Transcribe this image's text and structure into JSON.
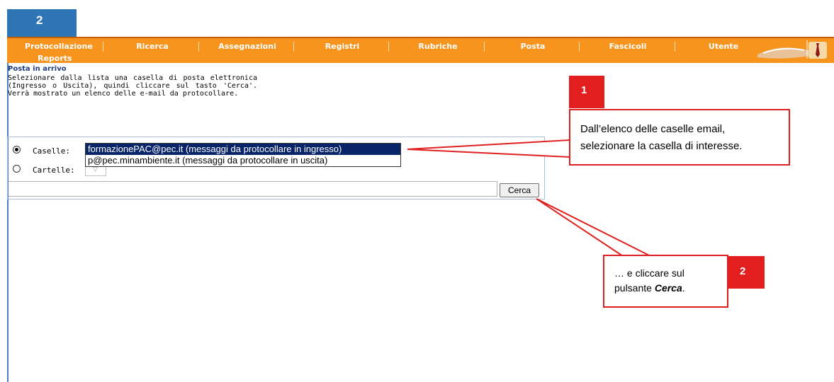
{
  "step_badge_top": "2",
  "nav": {
    "items": [
      "Protocollazione",
      "Ricerca",
      "Assegnazioni",
      "Registri",
      "Rubriche",
      "Posta",
      "Fascicoli",
      "Utente"
    ],
    "second_row": "Reports"
  },
  "page": {
    "section_title": "Posta in arrivo",
    "instructions": "Selezionare dalla lista una casella di posta elettronica (Ingresso o Uscita), quindi cliccare sul tasto 'Cerca'. Verrà mostrato un elenco delle e-mail da protocollare."
  },
  "form": {
    "radio_caselle_label": "Caselle:",
    "radio_cartelle_label": "Cartelle:",
    "dropdown_options": [
      "formazionePAC@pec.it (messaggi da protocollare in ingresso)",
      "p@pec.minambiente.it (messaggi da protocollare in uscita)"
    ],
    "search_value": "",
    "search_button": "Cerca"
  },
  "callouts": {
    "first": {
      "badge": "1",
      "line1": "Dall’elenco delle caselle email,",
      "line2": "selezionare la casella di interesse."
    },
    "second": {
      "badge": "2",
      "line1": "… e cliccare sul",
      "line2_prefix": "pulsante ",
      "line2_bold": "Cerca",
      "line2_suffix": "."
    }
  },
  "colors": {
    "nav_orange": "#f7941d",
    "badge_blue": "#2e75b6",
    "callout_red": "#e02020",
    "selection_blue": "#0a246a"
  }
}
